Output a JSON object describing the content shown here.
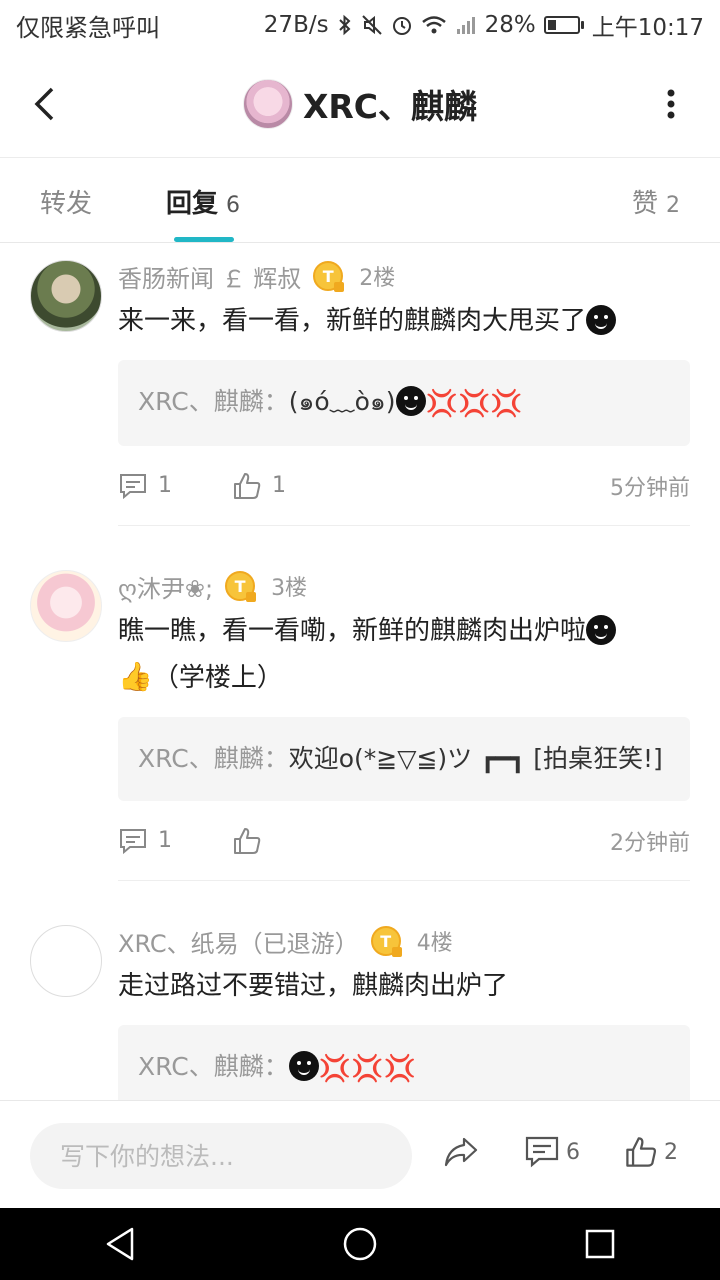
{
  "status_bar": {
    "emergency_text": "仅限紧急呼叫",
    "net_speed": "27B/s",
    "battery_percent": "28%",
    "battery_level": 0.28,
    "time": "上午10:17"
  },
  "header": {
    "title": "XRC、麒麟"
  },
  "tabs": {
    "forward_label": "转发",
    "reply_label": "回复",
    "reply_count": "6",
    "like_label": "赞",
    "like_count": "2",
    "accent_color": "#21b7c6"
  },
  "comments": [
    {
      "username": "香肠新闻 ￡ 辉叔",
      "badge": "T",
      "floor": "2楼",
      "content": "来一来，看一看，新鲜的麒麟肉大甩买了",
      "quote_name": "XRC、麒麟：",
      "quote_text": "(๑ó﹏ò๑)",
      "reply_count": "1",
      "like_count": "1",
      "time": "5分钟前"
    },
    {
      "username": "ღ沐尹❀;",
      "badge": "T",
      "floor": "3楼",
      "content": "瞧一瞧，看一看嘞，新鲜的麒麟肉出炉啦",
      "content_tail": "（学楼上）",
      "quote_name": "XRC、麒麟：",
      "quote_text": "欢迎o(*≧▽≦)ツ ┏━┓ [拍桌狂笑!]",
      "reply_count": "1",
      "like_count": "",
      "time": "2分钟前"
    },
    {
      "username": "XRC、纸易（已退游）",
      "badge": "T",
      "floor": "4楼",
      "content": "走过路过不要错过，麒麟肉出炉了",
      "quote_name": "XRC、麒麟：",
      "quote_text": ""
    }
  ],
  "bottom_bar": {
    "input_placeholder": "写下你的想法...",
    "comment_count": "6",
    "like_count": "2"
  }
}
